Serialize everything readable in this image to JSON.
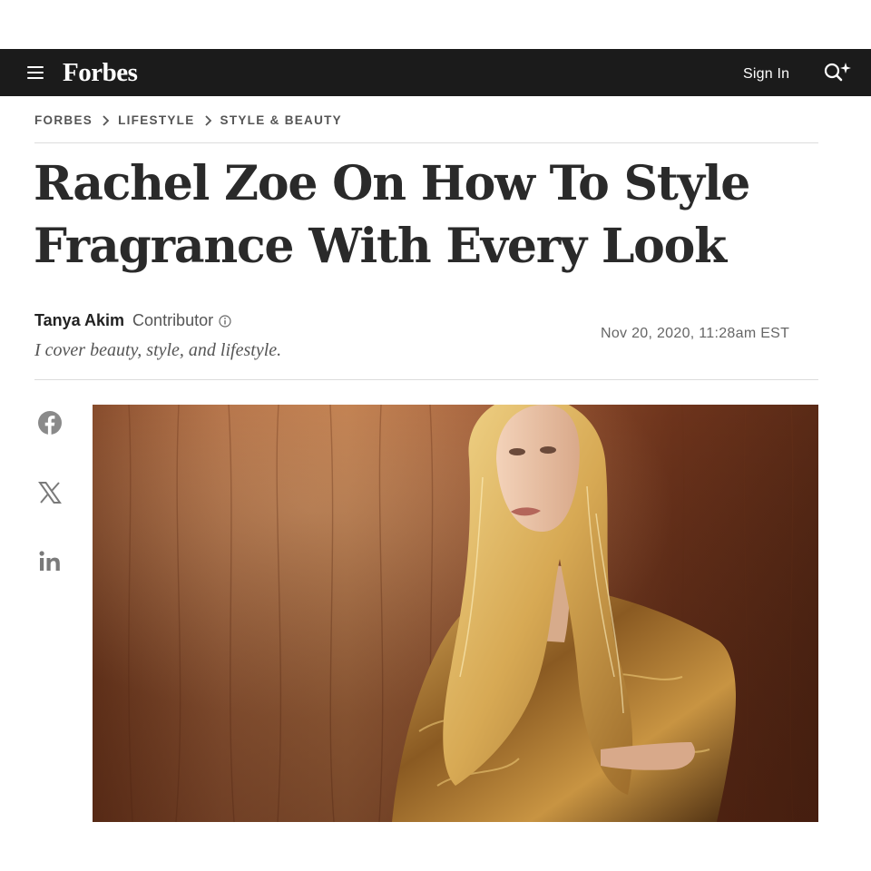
{
  "header": {
    "brand": "Forbes",
    "sign_in": "Sign In"
  },
  "icons": {
    "menu": "hamburger-menu-icon",
    "search": "search-sparkle-icon",
    "info": "info-icon",
    "share": [
      "facebook-icon",
      "x-icon",
      "linkedin-icon"
    ]
  },
  "breadcrumb": {
    "items": [
      "FORBES",
      "LIFESTYLE",
      "STYLE & BEAUTY"
    ]
  },
  "article": {
    "headline_line1": "Rachel Zoe On How To Style",
    "headline_line2": "Fragrance With Every Look",
    "author": "Tanya Akim",
    "role": "Contributor",
    "bio": "I cover beauty, style, and lifestyle.",
    "date": "Nov 20, 2020, 11:28am EST"
  },
  "colors": {
    "nav_background": "#1b1b1b",
    "headline_text": "#2a2a2a",
    "muted_text": "#555555"
  }
}
